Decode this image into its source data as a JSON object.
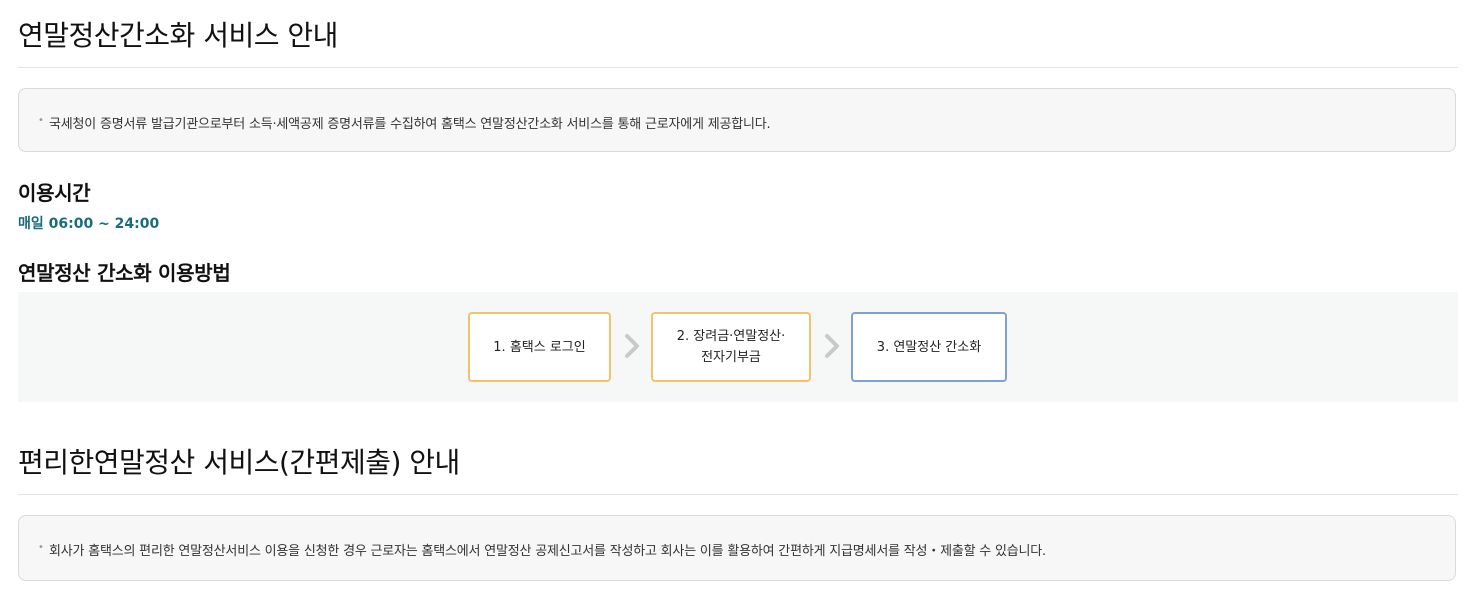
{
  "section1": {
    "title": "연말정산간소화 서비스 안내",
    "notice": "국세청이 증명서류 발급기관으로부터 소득·세액공제 증명서류를 수집하여 홈택스 연말정산간소화 서비스를 통해 근로자에게 제공합니다."
  },
  "hours": {
    "heading": "이용시간",
    "value": "매일 06:00 ~ 24:00"
  },
  "method": {
    "heading": "연말정산 간소화 이용방법",
    "steps": [
      {
        "line1": "1. 홈택스 로그인",
        "line2": ""
      },
      {
        "line1": "2. 장려금·연말정산·",
        "line2": "전자기부금"
      },
      {
        "line1": "3. 연말정산 간소화",
        "line2": ""
      }
    ]
  },
  "section2": {
    "title": "편리한연말정산 서비스(간편제출) 안내",
    "notice": "회사가 홈택스의 편리한 연말정산서비스 이용을 신청한 경우 근로자는 홈택스에서 연말정산 공제신고서를 작성하고 회사는 이를 활용하여 간편하게 지급명세서를 작성・제출할 수 있습니다."
  },
  "colors": {
    "accent_teal": "#1a6b7c",
    "step_border_orange": "#f5c26b",
    "step_border_blue": "#7da2cf"
  }
}
